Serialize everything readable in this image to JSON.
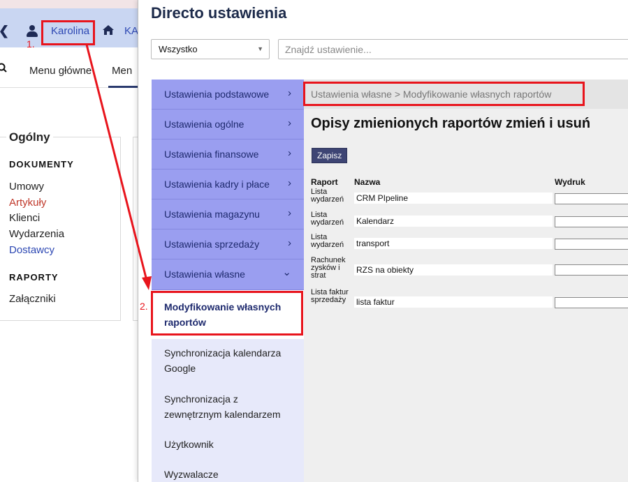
{
  "background_app": {
    "username": "Karolina",
    "company_partial": "KA",
    "nav_main": "Menu główne",
    "nav_menu_partial": "Men",
    "panel": {
      "legend": "Ogólny",
      "section_documents": "DOKUMENTY",
      "documents": [
        {
          "label": "Umowy",
          "color": "#222222"
        },
        {
          "label": "Artykuły",
          "color": "#c0392b"
        },
        {
          "label": "Klienci",
          "color": "#222222"
        },
        {
          "label": "Wydarzenia",
          "color": "#222222"
        },
        {
          "label": "Dostawcy",
          "color": "#2d48b3"
        }
      ],
      "section_reports": "RAPORTY",
      "reports": [
        {
          "label": "Załączniki"
        }
      ]
    }
  },
  "dialog": {
    "title": "Directo ustawienia",
    "filter_value": "Wszystko",
    "search_placeholder": "Znajdź ustawienie...",
    "sidebar": {
      "categories": [
        {
          "label": "Ustawienia podstawowe",
          "chevron": "›"
        },
        {
          "label": "Ustawienia ogólne",
          "chevron": "›"
        },
        {
          "label": "Ustawienia finansowe",
          "chevron": "›"
        },
        {
          "label": "Ustawienia kadry i płace",
          "chevron": "›"
        },
        {
          "label": "Ustawienia magazynu",
          "chevron": "›"
        },
        {
          "label": "Ustawienia sprzedaży",
          "chevron": "›"
        },
        {
          "label": "Ustawienia własne",
          "chevron": "⌄"
        }
      ],
      "active_item": "Modyfikowanie własnych raportów",
      "sub_items": [
        {
          "label": "Synchronizacja kalendarza Google"
        },
        {
          "label": "Synchronizacja z zewnętrznym kalendarzem"
        },
        {
          "label": "Użytkownik"
        },
        {
          "label": "Wyzwalacze"
        }
      ]
    },
    "breadcrumb": "Ustawienia własne > Modyfikowanie własnych raportów",
    "content_title": "Opisy zmienionych raportów zmień i usuń",
    "save_label": "Zapisz",
    "table": {
      "headers": {
        "raport": "Raport",
        "nazwa": "Nazwa",
        "wydruk": "Wydruk"
      },
      "rows": [
        {
          "raport": "Lista wydarzeń",
          "nazwa": "CRM PIpeline",
          "wydruk": ""
        },
        {
          "raport": "Lista wydarzeń",
          "nazwa": "Kalendarz",
          "wydruk": ""
        },
        {
          "raport": "Lista wydarzeń",
          "nazwa": "transport",
          "wydruk": ""
        },
        {
          "raport": "Rachunek zysków i strat",
          "nazwa": "RZS na obiekty",
          "wydruk": ""
        },
        {
          "raport": "Lista faktur sprzedaży",
          "nazwa": "lista faktur",
          "wydruk": ""
        }
      ]
    }
  },
  "annotations": {
    "step1": "1.",
    "step2": "2.",
    "color": "#e8141c"
  }
}
